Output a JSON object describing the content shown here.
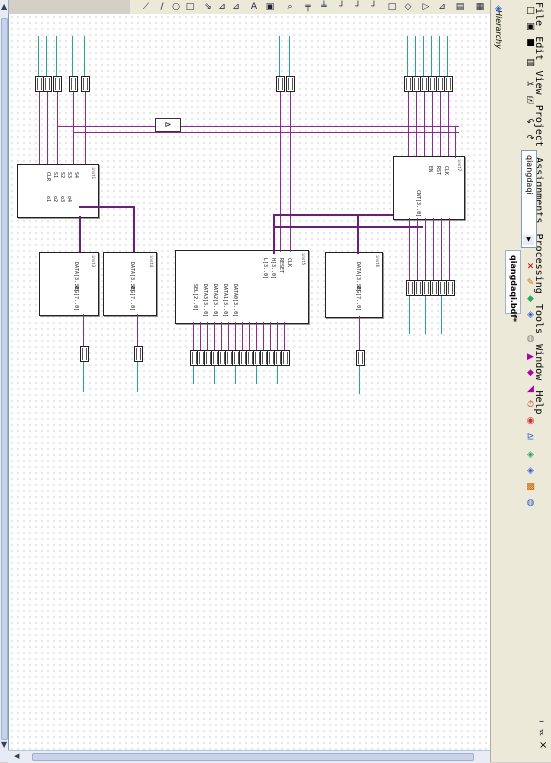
{
  "app": {
    "menu": [
      "File",
      "Edit",
      "View",
      "Project",
      "Assignments",
      "Processing",
      "Tools",
      "Window",
      "Help"
    ],
    "window_controls": [
      "–",
      "♯",
      "×"
    ]
  },
  "project": {
    "combo_value": "qiangdaqi",
    "doc_tab": "qiangdaqi.bdf*",
    "panel_title": "Hierarchy"
  },
  "schematic": {
    "inst1_label": "inst1",
    "inst2_label": "inst2",
    "inst3_label": "inst3",
    "inst4_label": "inst4",
    "inst5_label": "inst5",
    "inst6_label": "inst6",
    "inst7_label": "inst7",
    "inst1_pins": [
      "CLR",
      "S1",
      "S2",
      "S3",
      "S4",
      "o1",
      "o2",
      "o3",
      "o4"
    ],
    "inst2_pins": [
      "CLK",
      "EN",
      "RST",
      "COUNT[3..0]",
      "BUZZER"
    ],
    "inst3_pins": [
      "DATA[3..0]",
      "SEG[7..0]"
    ],
    "inst4_pins": [
      "DATA[3..0]",
      "SEG[7..0]"
    ],
    "inst5_pins": [
      "CLK",
      "RESET",
      "H[3..0]",
      "L[3..0]",
      "DATA0[3..0]",
      "DATA1[3..0]",
      "DATA2[3..0]",
      "DATA3[3..0]",
      "SEL[2..0]"
    ],
    "inst6_pins": [
      "DATA[3..0]",
      "SEG[7..0]"
    ],
    "inst7_pins": [
      "CLK",
      "RST",
      "EN",
      "CNT[3..0]"
    ]
  },
  "colors": {
    "wire": "#6b1f7a",
    "accent": "#2aa0a0"
  }
}
